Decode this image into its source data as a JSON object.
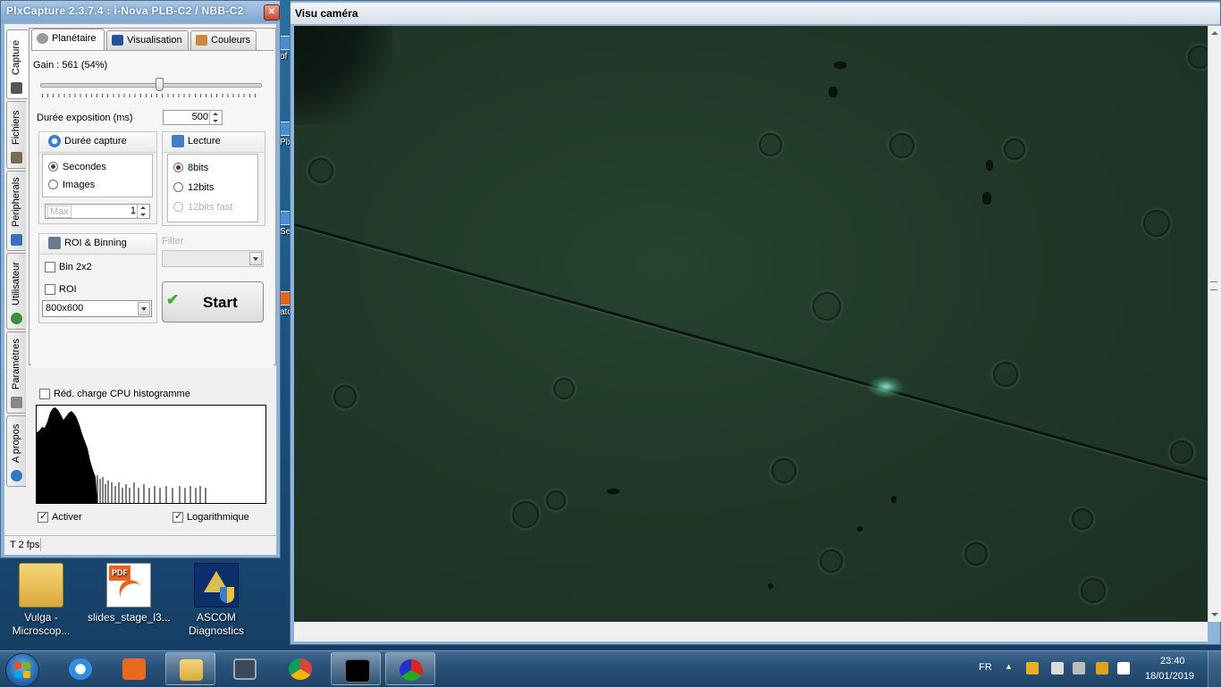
{
  "desktop": {
    "icons": [
      {
        "label": "Vulga -\nMicroscop...",
        "icon": "folder-icon"
      },
      {
        "label": "slides_stage_l3...",
        "icon": "pdf-icon"
      },
      {
        "label": "ASCOM\nDiagnostics",
        "icon": "ascom-icon"
      }
    ],
    "edge_fragments": [
      "of",
      "Plx",
      "Se",
      "ato"
    ]
  },
  "plx_window": {
    "title": "PlxCapture 2.3.7.4 : i-Nova PLB-C2 / NBB-C2",
    "close_label": "✕",
    "side_tabs": [
      "Capture",
      "Fichiers",
      "Peripherals",
      "Utilisateur",
      "Paramètres",
      "A propos"
    ],
    "top_tabs": [
      "Planétaire",
      "Visualisation",
      "Couleurs"
    ],
    "gain_label": "Gain : 561 (54%)",
    "gain_fraction": 0.54,
    "exposure_label": "Durée exposition (ms)",
    "exposure_value": "500",
    "duree_capture": {
      "title": "Durée capture",
      "options": [
        "Secondes",
        "Images"
      ],
      "selected": "Secondes",
      "max_placeholder": "Max",
      "max_value": "1"
    },
    "lecture": {
      "title": "Lecture",
      "options": [
        "8bits",
        "12bits",
        "12bits fast"
      ],
      "selected": "8bits",
      "disabled": [
        "12bits fast"
      ]
    },
    "roi": {
      "title": "ROI & Binning",
      "bin_label": "Bin 2x2",
      "roi_label": "ROI",
      "resolution": "800x600"
    },
    "filter_label": "Filter",
    "filter_value": "",
    "start_label": "Start",
    "cpu_label": "Réd. charge CPU histogramme",
    "activer_label": "Activer",
    "activer_checked": true,
    "log_label": "Logarithmique",
    "log_checked": true,
    "status_text": "T 2 fps"
  },
  "visu_window": {
    "title": "Visu caméra"
  },
  "taskbar": {
    "apps": [
      "windows-start",
      "internet-explorer",
      "media-player",
      "file-explorer",
      "video-app",
      "chrome",
      "capture-app",
      "plxcapture"
    ],
    "language": "FR",
    "time": "23:40",
    "date": "18/01/2019"
  }
}
